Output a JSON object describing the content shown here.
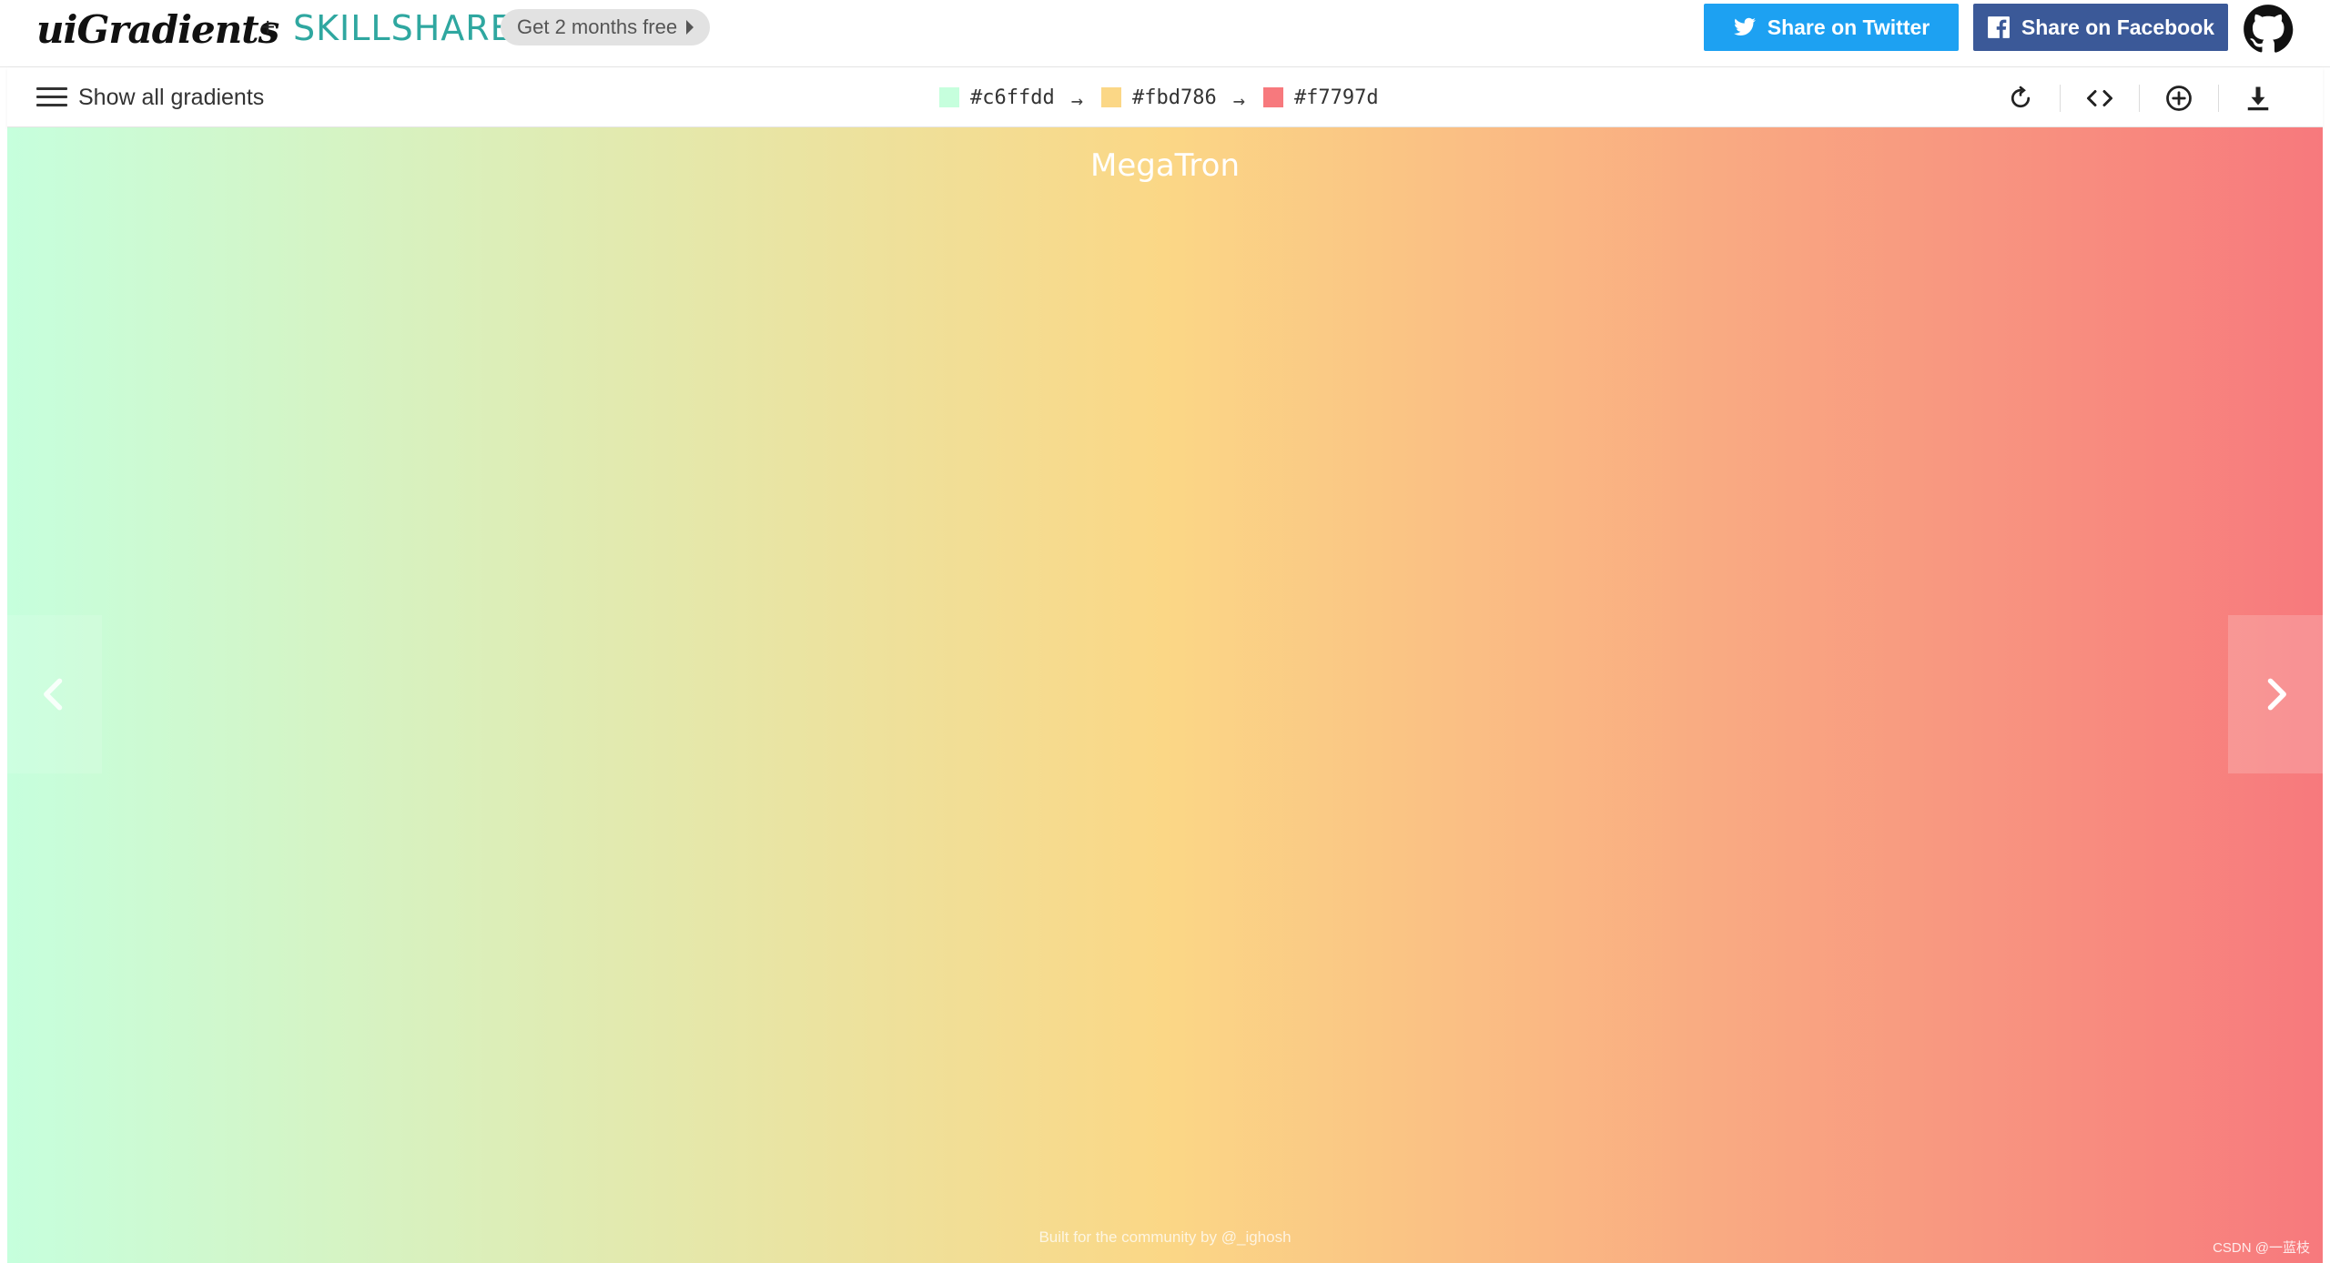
{
  "header": {
    "logo_text": "uiGradients",
    "plus": "+",
    "partner": "SKILLSHARE",
    "promo_label": "Get 2 months free",
    "share_twitter_label": "Share on Twitter",
    "share_facebook_label": "Share on Facebook"
  },
  "toolbar": {
    "show_all_label": "Show all gradients",
    "stops": [
      {
        "hex": "#c6ffdd",
        "label": "#c6ffdd"
      },
      {
        "hex": "#fbd786",
        "label": "#fbd786"
      },
      {
        "hex": "#f7797d",
        "label": "#f7797d"
      }
    ],
    "arrow": "→",
    "tools": [
      "rotate-icon",
      "code-icon",
      "add-circle-icon",
      "download-icon"
    ]
  },
  "stage": {
    "gradient_name": "MegaTron",
    "credit": "Built for the community by @_ighosh",
    "watermark": "CSDN @一蓝枝"
  },
  "colors": {
    "twitter": "#1da1f2",
    "facebook": "#3b5998",
    "skillshare": "#2fa7a0"
  }
}
